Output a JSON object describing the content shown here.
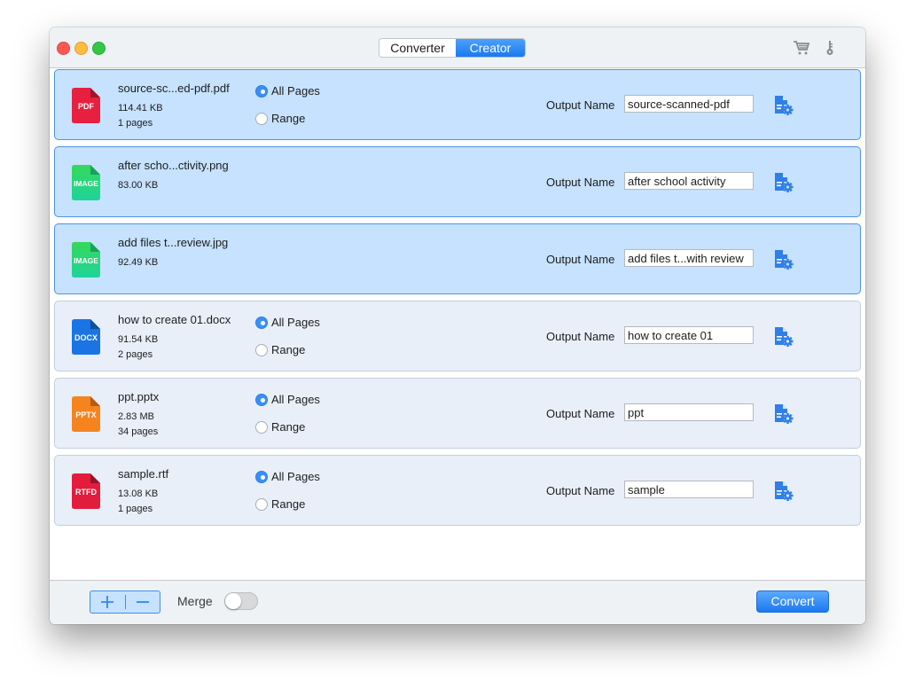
{
  "window": {
    "controls": [
      "close",
      "minimize",
      "maximize"
    ]
  },
  "toolbar": {
    "tabs": [
      {
        "label": "Converter",
        "active": false
      },
      {
        "label": "Creator",
        "active": true
      }
    ],
    "icons": [
      "cart-icon",
      "key-icon"
    ]
  },
  "colors": {
    "accent": "#1b78f2",
    "selected_row_bg": "#c6e2fe",
    "row_bg": "#e9eff9",
    "pdf": "#e31c3d",
    "image": "#2dd07a",
    "docx": "#1a73e0",
    "pptx": "#f07a1a",
    "rtfd": "#e31c3d"
  },
  "files": [
    {
      "name": "source-sc...ed-pdf.pdf",
      "type_badge": "PDF",
      "size": "114.41 KB",
      "pages": "1 pages",
      "selected": true,
      "has_page_options": true,
      "all_pages_label": "All Pages",
      "range_label": "Range",
      "page_mode": "all",
      "output_label": "Output Name",
      "output_name": "source-scanned-pdf"
    },
    {
      "name": "after scho...ctivity.png",
      "type_badge": "IMAGE",
      "size": "83.00 KB",
      "pages": null,
      "selected": true,
      "has_page_options": false,
      "output_label": "Output Name",
      "output_name": "after school activity"
    },
    {
      "name": "add files t...review.jpg",
      "type_badge": "IMAGE",
      "size": "92.49 KB",
      "pages": null,
      "selected": true,
      "has_page_options": false,
      "output_label": "Output Name",
      "output_name": "add files t...with review"
    },
    {
      "name": "how to create 01.docx",
      "type_badge": "DOCX",
      "size": "91.54 KB",
      "pages": "2 pages",
      "selected": false,
      "has_page_options": true,
      "all_pages_label": "All Pages",
      "range_label": "Range",
      "page_mode": "all",
      "output_label": "Output Name",
      "output_name": "how to create 01"
    },
    {
      "name": "ppt.pptx",
      "type_badge": "PPTX",
      "size": "2.83 MB",
      "pages": "34 pages",
      "selected": false,
      "has_page_options": true,
      "all_pages_label": "All Pages",
      "range_label": "Range",
      "page_mode": "all",
      "output_label": "Output Name",
      "output_name": "ppt"
    },
    {
      "name": "sample.rtf",
      "type_badge": "RTFD",
      "size": "13.08 KB",
      "pages": "1 pages",
      "selected": false,
      "has_page_options": true,
      "all_pages_label": "All Pages",
      "range_label": "Range",
      "page_mode": "all",
      "output_label": "Output Name",
      "output_name": "sample"
    }
  ],
  "footer": {
    "add_symbol": "+",
    "remove_symbol": "−",
    "merge_label": "Merge",
    "merge_on": false,
    "convert_label": "Convert"
  }
}
